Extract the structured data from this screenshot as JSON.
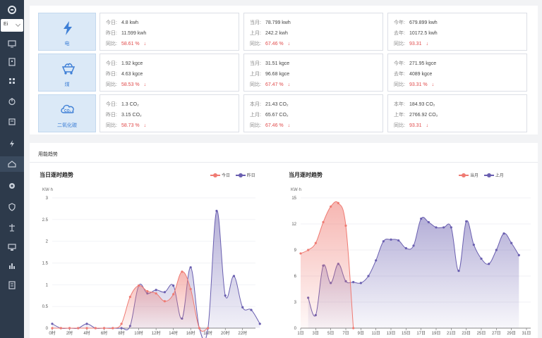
{
  "language": {
    "selected": "Ei"
  },
  "sidebar": {
    "items": [
      {
        "icon": "monitor-icon"
      },
      {
        "icon": "building-icon"
      },
      {
        "icon": "grid-icon"
      },
      {
        "icon": "power-icon"
      },
      {
        "icon": "meter-icon"
      },
      {
        "icon": "bolt-icon"
      },
      {
        "icon": "home-icon",
        "active": true
      },
      {
        "icon": "gear-icon"
      },
      {
        "icon": "shield-icon"
      },
      {
        "icon": "tower-icon"
      },
      {
        "icon": "device-icon"
      },
      {
        "icon": "bar-chart-icon"
      },
      {
        "icon": "report-icon"
      }
    ]
  },
  "energy": [
    {
      "label": "电",
      "icon": "bolt-icon",
      "day": {
        "l1": "今日:",
        "v1": "4.8 kwh",
        "l2": "昨日:",
        "v2": "11.599 kwh",
        "l3": "同比:",
        "v3": "58.61 %"
      },
      "month": {
        "l1": "当月:",
        "v1": "78.799 kwh",
        "l2": "上月:",
        "v2": "242.2 kwh",
        "l3": "同比:",
        "v3": "67.46 %"
      },
      "year": {
        "l1": "今年:",
        "v1": "679.899 kwh",
        "l2": "去年:",
        "v2": "10172.5 kwh",
        "l3": "同比:",
        "v3": "93.31"
      }
    },
    {
      "label": "煤",
      "icon": "coal-cart-icon",
      "day": {
        "l1": "今日:",
        "v1": "1.92 kgce",
        "l2": "昨日:",
        "v2": "4.63 kgce",
        "l3": "同比:",
        "v3": "58.53 %"
      },
      "month": {
        "l1": "当月:",
        "v1": "31.51 kgce",
        "l2": "上月:",
        "v2": "96.68 kgce",
        "l3": "同比:",
        "v3": "67.47 %"
      },
      "year": {
        "l1": "今年:",
        "v1": "271.95 kgce",
        "l2": "去年:",
        "v2": "4089 kgce",
        "l3": "同比:",
        "v3": "93.31 %"
      }
    },
    {
      "label": "二氧化碳",
      "icon": "co2-cloud-icon",
      "day": {
        "l1": "今日:",
        "v1": "1.3 CO₂",
        "l2": "昨日:",
        "v2": "3.15 CO₂",
        "l3": "同比:",
        "v3": "58.73 %"
      },
      "month": {
        "l1": "本月:",
        "v1": "21.43 CO₂",
        "l2": "上月:",
        "v2": "65.67 CO₂",
        "l3": "同比:",
        "v3": "67.46 %"
      },
      "year": {
        "l1": "本年:",
        "v1": "184.93 CO₂",
        "l2": "上年:",
        "v2": "2766.92 CO₂",
        "l3": "同比:",
        "v3": "93.31"
      }
    }
  ],
  "trend": {
    "title": "用能趋势"
  },
  "colors": {
    "today": "#ef7b73",
    "yesterday": "#6a5fb0",
    "accent": "#3e7fd6",
    "down": "#e04a4a"
  },
  "chart_data": [
    {
      "type": "area",
      "title": "当日逐时趋势",
      "ylabel": "KW·h",
      "ylim": [
        0,
        3
      ],
      "yticks": [
        "0",
        "0.5",
        "1",
        "1.5",
        "2",
        "2.5",
        "3"
      ],
      "xlabels": [
        "0时",
        "2时",
        "4时",
        "6时",
        "8时",
        "10时",
        "12时",
        "14时",
        "16时",
        "18时",
        "20时",
        "22时"
      ],
      "legend": [
        "今日",
        "昨日"
      ],
      "x": [
        0,
        1,
        2,
        3,
        4,
        5,
        6,
        7,
        8,
        9,
        10,
        11,
        12,
        13,
        14,
        15,
        16,
        17,
        18,
        19,
        20,
        21,
        22,
        23
      ],
      "series": [
        {
          "name": "今日",
          "values": [
            0,
            0,
            0,
            0,
            0,
            0,
            0,
            0,
            0.1,
            0.72,
            0.98,
            0.85,
            0.8,
            0.62,
            0.78,
            1.3,
            0.9,
            0,
            0
          ]
        },
        {
          "name": "昨日",
          "values": [
            0.1,
            0,
            0,
            0,
            0.1,
            0,
            0,
            0,
            0,
            0.05,
            0.98,
            0.8,
            0.88,
            0.83,
            0.98,
            0.22,
            1.4,
            0,
            0,
            2.7,
            0.75,
            1.2,
            0.48,
            0.42,
            0.1
          ]
        }
      ]
    },
    {
      "type": "area",
      "title": "当月逐时趋势",
      "ylabel": "KW·h",
      "ylim": [
        0,
        15
      ],
      "yticks": [
        "0",
        "3",
        "6",
        "9",
        "12",
        "15"
      ],
      "xlabels": [
        "1日",
        "3日",
        "5日",
        "7日",
        "9日",
        "11日",
        "13日",
        "15日",
        "17日",
        "19日",
        "21日",
        "23日",
        "25日",
        "27日",
        "29日",
        "31日"
      ],
      "legend": [
        "当月",
        "上月"
      ],
      "series": [
        {
          "name": "当月",
          "values": [
            8.6,
            9.0,
            9.8,
            12.2,
            14.0,
            14.4,
            11.8,
            0
          ]
        },
        {
          "name": "上月",
          "values": [
            null,
            3.5,
            1.5,
            7.2,
            5.2,
            7.4,
            5.4,
            5.3,
            5.2,
            6.0,
            7.8,
            10.0,
            10.2,
            10.1,
            9.2,
            9.5,
            12.6,
            12.2,
            11.6,
            11.6,
            11.6,
            6.6,
            12.3,
            9.6,
            8.0,
            7.4,
            9.0,
            10.9,
            9.8,
            8.4
          ]
        }
      ]
    }
  ]
}
